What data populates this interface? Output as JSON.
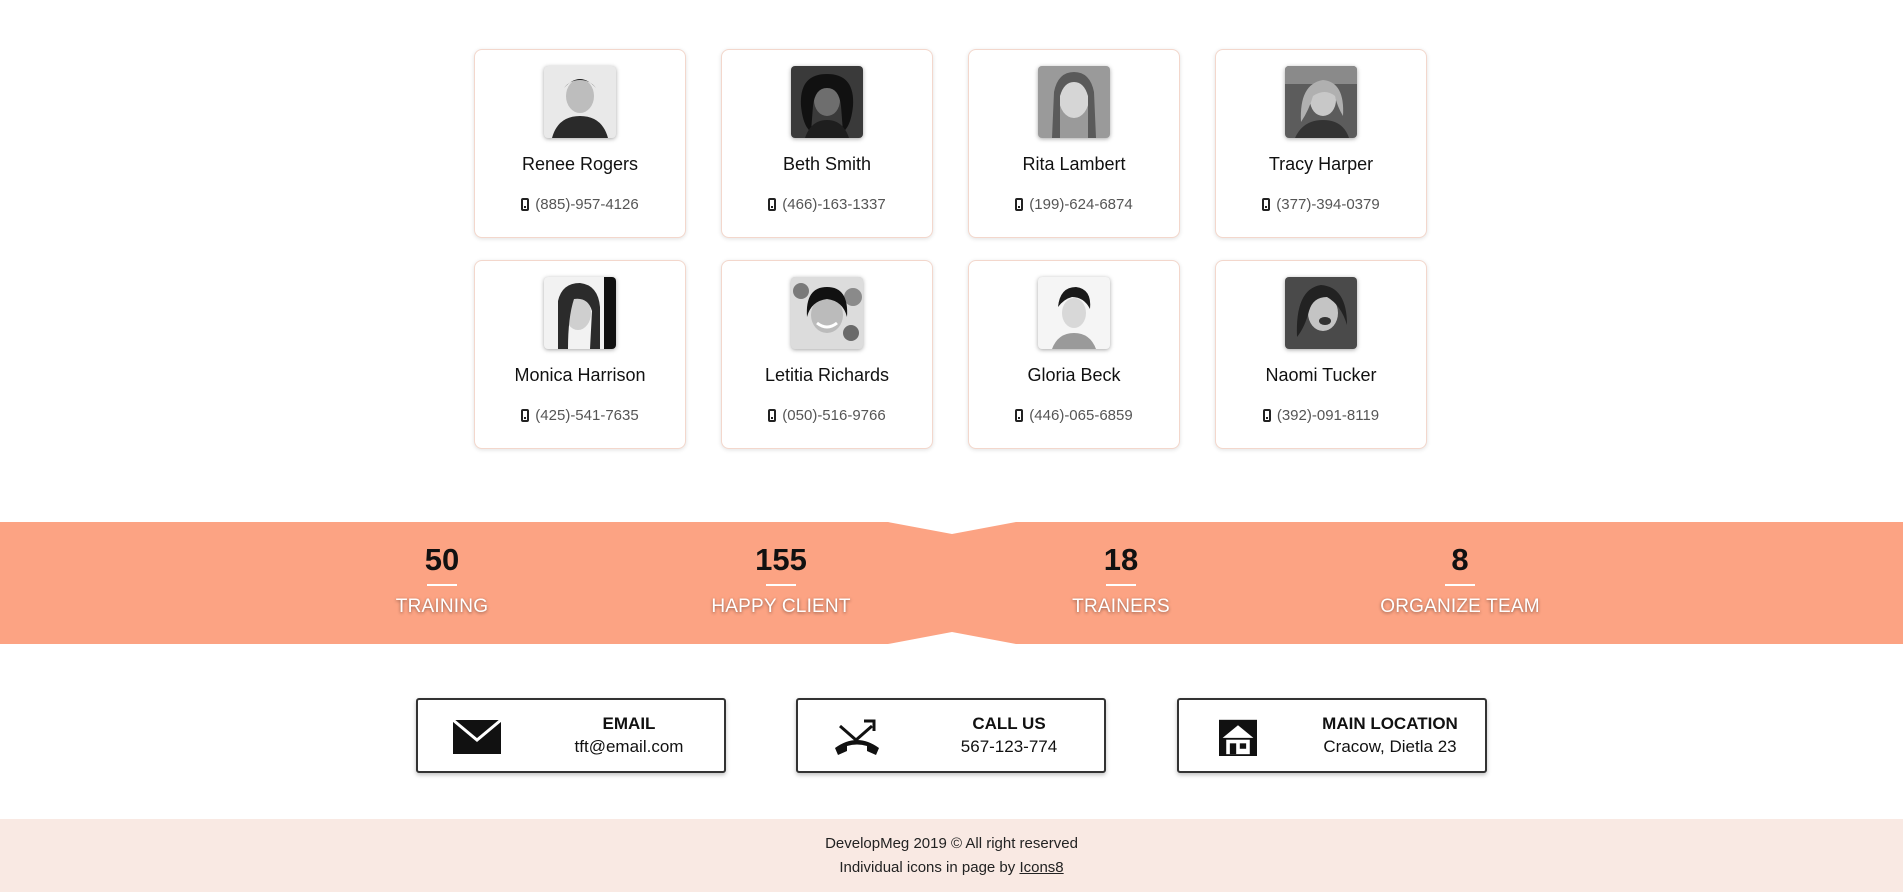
{
  "team": {
    "members": [
      {
        "name": "Renee Rogers",
        "phone": "(885)-957-4126"
      },
      {
        "name": "Beth Smith",
        "phone": "(466)-163-1337"
      },
      {
        "name": "Rita Lambert",
        "phone": "(199)-624-6874"
      },
      {
        "name": "Tracy Harper",
        "phone": "(377)-394-0379"
      },
      {
        "name": "Monica Harrison",
        "phone": "(425)-541-7635"
      },
      {
        "name": "Letitia Richards",
        "phone": "(050)-516-9766"
      },
      {
        "name": "Gloria Beck",
        "phone": "(446)-065-6859"
      },
      {
        "name": "Naomi Tucker",
        "phone": "(392)-091-8119"
      }
    ]
  },
  "stats": {
    "band_color": "#fca383",
    "items": [
      {
        "number": "50",
        "label": "TRAINING"
      },
      {
        "number": "155",
        "label": "HAPPY CLIENT"
      },
      {
        "number": "18",
        "label": "TRAINERS"
      },
      {
        "number": "8",
        "label": "ORGANIZE TEAM"
      }
    ]
  },
  "contact": {
    "email": {
      "title": "EMAIL",
      "value": "tft@email.com",
      "icon": "envelope-icon"
    },
    "call": {
      "title": "CALL US",
      "value": "567-123-774",
      "icon": "phone-call-icon"
    },
    "location": {
      "title": "MAIN LOCATION",
      "value": "Cracow, Dietla 23",
      "icon": "house-icon"
    }
  },
  "footer": {
    "copyright": "DevelopMeg 2019 © All right reserved",
    "credit_prefix": "Individual icons in page by",
    "credit_link": "Icons8",
    "background": "#f9e9e3"
  }
}
